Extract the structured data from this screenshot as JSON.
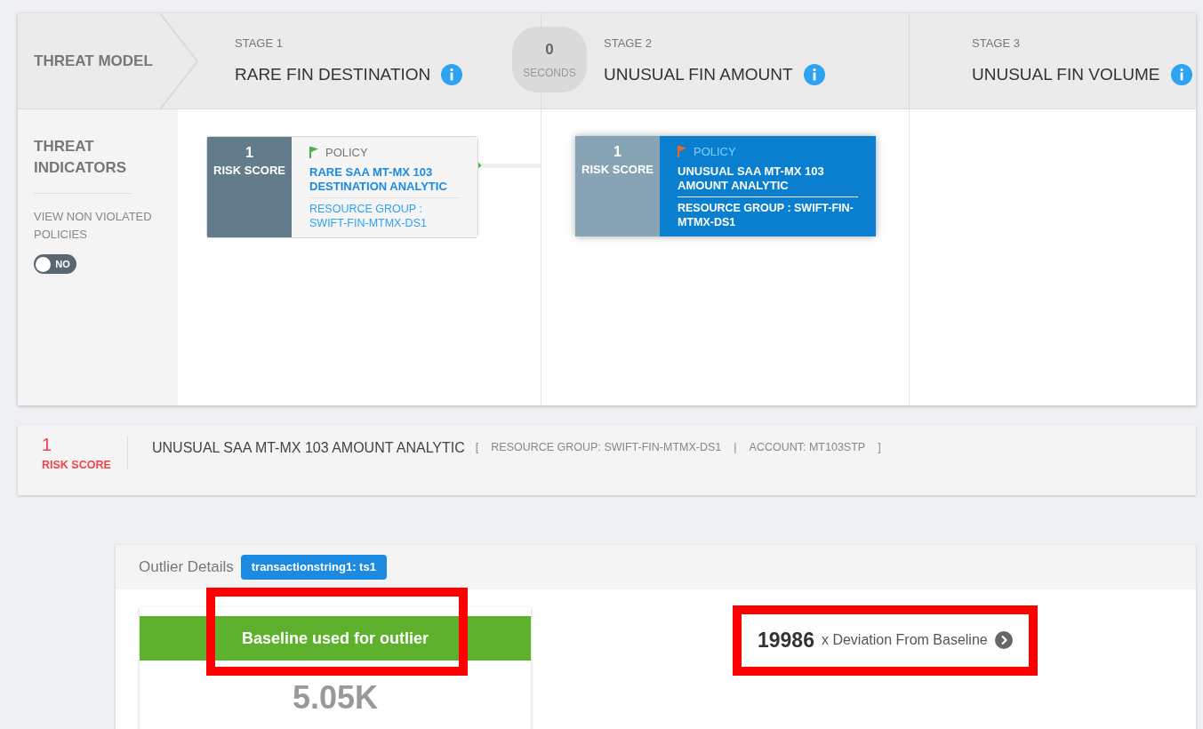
{
  "header": {
    "title": "THREAT MODEL"
  },
  "timer": {
    "value": "0",
    "unit": "SECONDS"
  },
  "stages": [
    {
      "label": "STAGE 1",
      "name": "RARE FIN DESTINATION",
      "policies": [
        {
          "score": "1",
          "score_label": "RISK SCORE",
          "tag": "POLICY",
          "color": "#4caf50",
          "name": "RARE SAA MT-MX 103 DESTINATION ANALYTIC",
          "group": "RESOURCE GROUP : SWIFT-FIN-MTMX-DS1",
          "selected": false
        }
      ]
    },
    {
      "label": "STAGE 2",
      "name": "UNUSUAL FIN AMOUNT",
      "policies": [
        {
          "score": "1",
          "score_label": "RISK SCORE",
          "tag": "POLICY",
          "color": "#f26522",
          "name": "UNUSUAL SAA MT-MX 103 AMOUNT ANALYTIC",
          "group": "RESOURCE GROUP : SWIFT-FIN-MTMX-DS1",
          "selected": true
        }
      ]
    },
    {
      "label": "STAGE 3",
      "name": "UNUSUAL FIN VOLUME"
    }
  ],
  "sidebar": {
    "title": "THREAT INDICATORS",
    "toggle_label": "VIEW NON VIOLATED POLICIES",
    "toggle": {
      "on": false,
      "text": "NO"
    }
  },
  "detail": {
    "score": "1",
    "score_label": "RISK SCORE",
    "name": "UNUSUAL SAA MT-MX 103 AMOUNT ANALYTIC",
    "meta": [
      "[",
      "RESOURCE GROUP: SWIFT-FIN-MTMX-DS1",
      "|",
      "ACCOUNT: MT103STP",
      "]"
    ]
  },
  "outlier": {
    "title": "Outlier Details",
    "tag": "transactionstring1: ts1",
    "baseline": {
      "title": "Baseline used for outlier",
      "value": "5.05K",
      "highlighted": true
    },
    "deviation": {
      "value": "19986",
      "text": "x Deviation From Baseline",
      "highlighted": true
    }
  }
}
